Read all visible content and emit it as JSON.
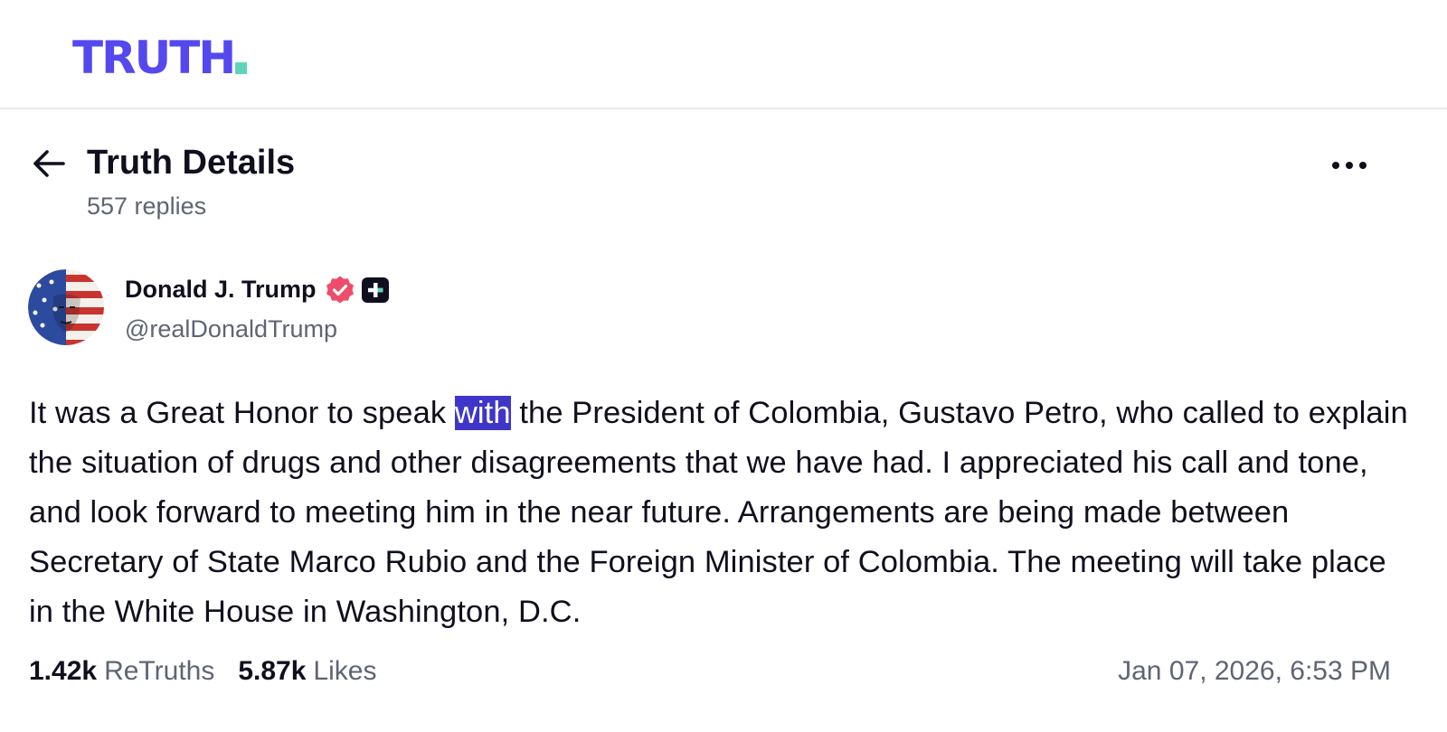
{
  "brand": {
    "logo_text": "TRUTH",
    "primary_color": "#5448ee",
    "accent_color": "#5fd3bc"
  },
  "header": {
    "back_icon": "arrow-left-icon",
    "title": "Truth Details",
    "replies": "557 replies",
    "more_icon": "more-horizontal-icon"
  },
  "post": {
    "author": {
      "name": "Donald J. Trump",
      "handle": "@realDonaldTrump",
      "verified_icon": "verified-badge-icon",
      "verified_color": "#ee4c6b",
      "plus_icon": "truth-plus-badge-icon"
    },
    "text_before": "It was a Great Honor to speak ",
    "text_highlight": "with",
    "text_after": " the President of Colombia, Gustavo Petro, who called to explain the situation of drugs and other disagreements that we have had. I appreciated his call and tone, and look forward to meeting him in the near future. Arrangements are being made between Secretary of State Marco Rubio and the Foreign Minister of Colombia. The meeting will take place in the White House in Washington, D.C.",
    "selection_color": "#3f36c9",
    "stats": {
      "retruths_count": "1.42k",
      "retruths_label": "ReTruths",
      "likes_count": "5.87k",
      "likes_label": "Likes"
    },
    "timestamp": "Jan 07, 2026, 6:53 PM"
  }
}
